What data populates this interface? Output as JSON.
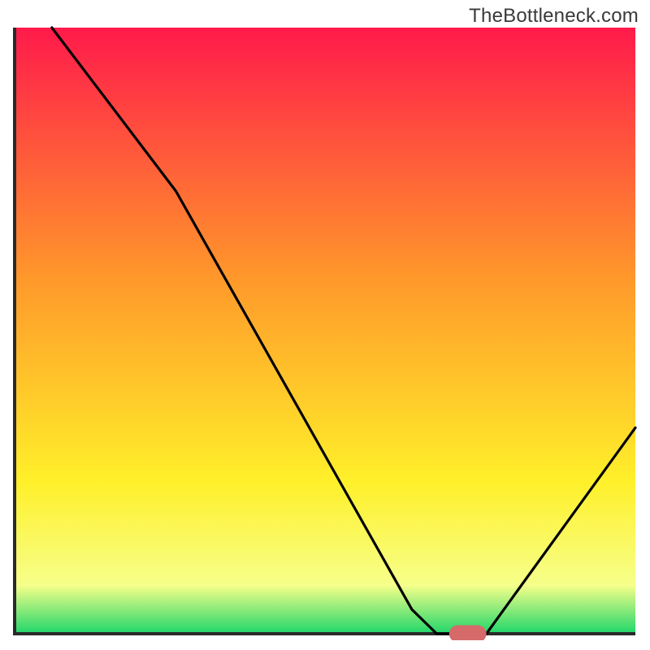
{
  "watermark": "TheBottleneck.com",
  "colors": {
    "red": "#ff1a4b",
    "orange": "#ff9a2a",
    "yellow": "#fff02a",
    "lemon": "#f6ff8a",
    "green": "#1fd66a",
    "curve": "#000000",
    "marker": "#d66a6a",
    "axis": "#2a2a2a"
  },
  "gradient_stops": [
    {
      "offset": 0.0,
      "color_key": "red"
    },
    {
      "offset": 0.42,
      "color_key": "orange"
    },
    {
      "offset": 0.75,
      "color_key": "yellow"
    },
    {
      "offset": 0.92,
      "color_key": "lemon"
    },
    {
      "offset": 1.0,
      "color_key": "green"
    }
  ],
  "chart_data": {
    "type": "line",
    "title": "",
    "xlabel": "",
    "ylabel": "",
    "xlim": [
      0,
      100
    ],
    "ylim": [
      0,
      100
    ],
    "grid": false,
    "legend": null,
    "curve": [
      {
        "x": 6,
        "y": 100
      },
      {
        "x": 26,
        "y": 73
      },
      {
        "x": 64,
        "y": 4
      },
      {
        "x": 68,
        "y": 0
      },
      {
        "x": 76,
        "y": 0
      },
      {
        "x": 100,
        "y": 34
      }
    ],
    "marker": {
      "x_start": 70,
      "x_end": 76,
      "y": 0,
      "radius": 1.4
    }
  }
}
